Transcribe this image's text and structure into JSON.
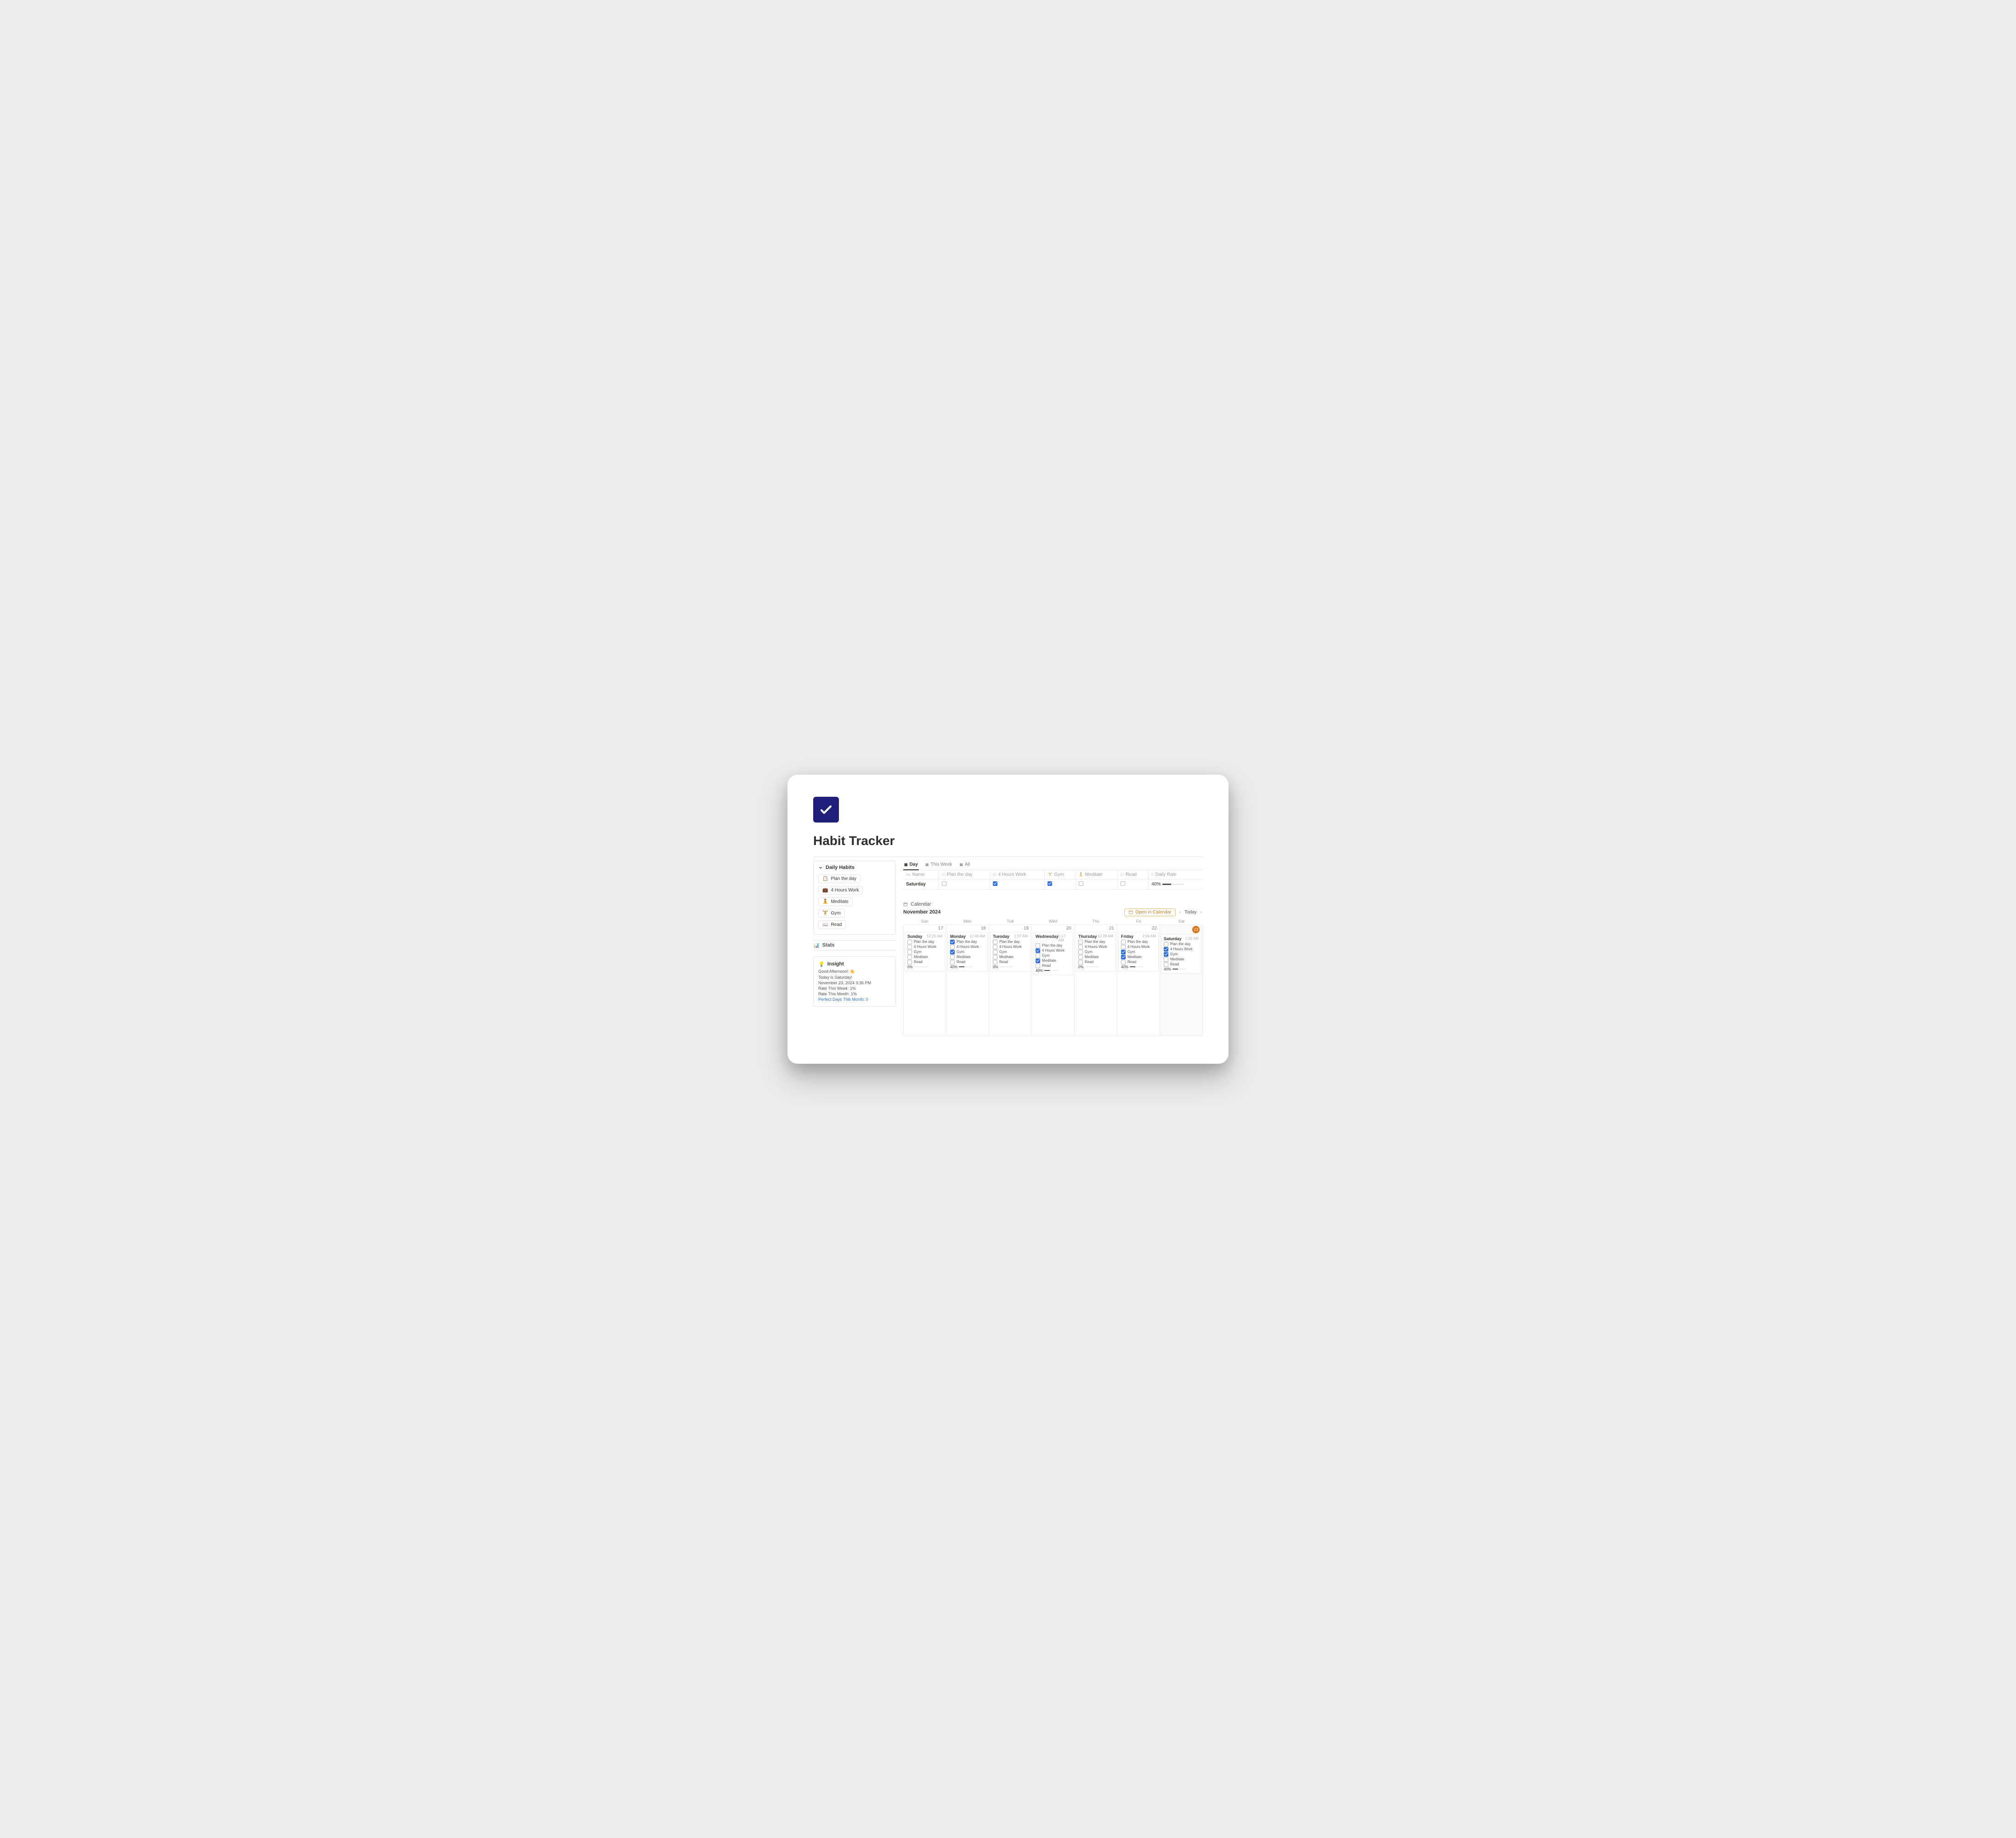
{
  "page": {
    "title": "Habit Tracker"
  },
  "sidebar": {
    "daily_habits_title": "Daily Habits",
    "habits": [
      {
        "icon": "📋",
        "label": "Plan the day"
      },
      {
        "icon": "💼",
        "label": "4 Hours Work"
      },
      {
        "icon": "🧘",
        "label": "Meditate"
      },
      {
        "icon": "🏋️",
        "label": "Gym"
      },
      {
        "icon": "📖",
        "label": "Read"
      }
    ],
    "stats_label": "Stats",
    "insight": {
      "title": "Insight",
      "greeting": "Good Afternoon! 👋",
      "today_is": "Today is Saturday!",
      "now": "November 23, 2024 3:36 PM",
      "rate_week": "Rate This Week: 1%",
      "rate_month": "Rate This Month: 1%",
      "perfect_days": "Perfect Days This Month: 0"
    }
  },
  "tabs": [
    {
      "label": "Day",
      "active": true
    },
    {
      "label": "This Week",
      "active": false
    },
    {
      "label": "All",
      "active": false
    }
  ],
  "table": {
    "columns": [
      "Name",
      "Plan the day",
      "4 Hours Work",
      "Gym",
      "Meditate",
      "Read",
      "Daily Rate"
    ],
    "row": {
      "name": "Saturday",
      "plan": false,
      "work": true,
      "gym": true,
      "meditate": false,
      "read": false,
      "rate_label": "40%",
      "rate_pct": 40
    }
  },
  "calendar": {
    "header": "Calendar",
    "month": "November 2024",
    "open_label": "Open in Calendar",
    "today_label": "Today",
    "weekdays": [
      "Sun",
      "Mon",
      "Tue",
      "Wed",
      "Thu",
      "Fri",
      "Sat"
    ],
    "days": [
      {
        "date": "17",
        "today": false,
        "title": "Sunday",
        "time": "12:26 AM",
        "habits": {
          "plan": false,
          "work": false,
          "gym": false,
          "meditate": false,
          "read": false
        },
        "rate": "0%",
        "rate_pct": 0
      },
      {
        "date": "18",
        "today": false,
        "title": "Monday",
        "time": "12:46 AM",
        "habits": {
          "plan": true,
          "work": false,
          "gym": true,
          "meditate": false,
          "read": false
        },
        "rate": "40%",
        "rate_pct": 40
      },
      {
        "date": "19",
        "today": false,
        "title": "Tuesday",
        "time": "2:57 AM",
        "habits": {
          "plan": false,
          "work": false,
          "gym": false,
          "meditate": false,
          "read": false
        },
        "rate": "0%",
        "rate_pct": 0
      },
      {
        "date": "20",
        "today": false,
        "title": "Wednesday",
        "time": "1:17 AM",
        "habits": {
          "plan": false,
          "work": true,
          "gym": false,
          "meditate": true,
          "read": false
        },
        "rate": "40%",
        "rate_pct": 40
      },
      {
        "date": "21",
        "today": false,
        "title": "Thursday",
        "time": "12:39 AM",
        "habits": {
          "plan": false,
          "work": false,
          "gym": false,
          "meditate": false,
          "read": false
        },
        "rate": "0%",
        "rate_pct": 0
      },
      {
        "date": "22",
        "today": false,
        "title": "Friday",
        "time": "2:04 AM",
        "habits": {
          "plan": false,
          "work": false,
          "gym": true,
          "meditate": true,
          "read": false
        },
        "rate": "40%",
        "rate_pct": 40
      },
      {
        "date": "23",
        "today": true,
        "title": "Saturday",
        "time": "1:15 AM",
        "habits": {
          "plan": false,
          "work": true,
          "gym": true,
          "meditate": false,
          "read": false
        },
        "rate": "40%",
        "rate_pct": 40
      }
    ],
    "habit_labels": {
      "plan": "Plan the day",
      "work": "4 Hours Work",
      "gym": "Gym",
      "meditate": "Meditate",
      "read": "Read"
    }
  }
}
